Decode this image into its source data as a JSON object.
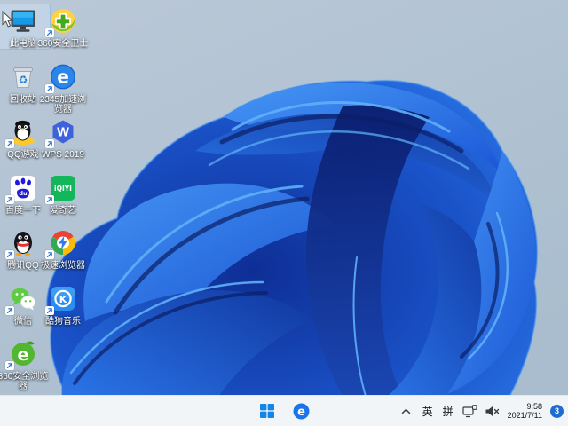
{
  "wallpaper": {
    "name": "windows-11-bloom",
    "description": "blue ribbon bloom on light blue-gray background"
  },
  "colors": {
    "background_top": "#bac8d7",
    "background_bottom": "#a9bdce",
    "bloom_bright": "#2e7ff0",
    "bloom_mid": "#1a52c8",
    "bloom_dark": "#0a1d6e",
    "taskbar_bg": "#f2f5f8",
    "selection_highlight": "#cde3f7",
    "badge": "#1f6cd0"
  },
  "desktop": {
    "icons": [
      {
        "id": "this-pc",
        "label": "此电脑",
        "glyph": "this-pc-icon",
        "col": 0,
        "row": 0,
        "shortcut": false,
        "selected": true
      },
      {
        "id": "360-safety",
        "label": "360安全卫士",
        "glyph": "shield-360-icon",
        "col": 1,
        "row": 0,
        "shortcut": true,
        "selected": false
      },
      {
        "id": "recycle-bin",
        "label": "回收站",
        "glyph": "recycle-bin-icon",
        "col": 0,
        "row": 1,
        "shortcut": false,
        "selected": false
      },
      {
        "id": "2345-browser",
        "label": "2345加速浏览器",
        "glyph": "browser-e-icon",
        "col": 1,
        "row": 1,
        "shortcut": true,
        "selected": false
      },
      {
        "id": "qq-games",
        "label": "QQ游戏",
        "glyph": "qq-game-icon",
        "col": 0,
        "row": 2,
        "shortcut": true,
        "selected": false
      },
      {
        "id": "wps-2019",
        "label": "WPS 2019",
        "glyph": "wps-icon",
        "col": 1,
        "row": 2,
        "shortcut": true,
        "selected": false
      },
      {
        "id": "baidu",
        "label": "百度一下",
        "glyph": "baidu-icon",
        "col": 0,
        "row": 3,
        "shortcut": true,
        "selected": false
      },
      {
        "id": "iqiyi",
        "label": "爱奇艺",
        "glyph": "iqiyi-icon",
        "col": 1,
        "row": 3,
        "shortcut": true,
        "selected": false
      },
      {
        "id": "tencent-qq",
        "label": "腾讯QQ",
        "glyph": "qq-icon",
        "col": 0,
        "row": 4,
        "shortcut": true,
        "selected": false
      },
      {
        "id": "speed-browser",
        "label": "极速浏览器",
        "glyph": "chrome-speed-icon",
        "col": 1,
        "row": 4,
        "shortcut": true,
        "selected": false
      },
      {
        "id": "wechat",
        "label": "微信",
        "glyph": "wechat-icon",
        "col": 0,
        "row": 5,
        "shortcut": true,
        "selected": false
      },
      {
        "id": "kugou-music",
        "label": "酷狗音乐",
        "glyph": "kugou-icon",
        "col": 1,
        "row": 5,
        "shortcut": true,
        "selected": false
      },
      {
        "id": "360-browser",
        "label": "360安全浏览器",
        "glyph": "browser-360-icon",
        "col": 0,
        "row": 6,
        "shortcut": true,
        "selected": false
      }
    ]
  },
  "taskbar": {
    "start": {
      "glyph": "windows-start-icon"
    },
    "pinned": [
      {
        "id": "browser",
        "glyph": "edge-e-icon"
      }
    ],
    "tray": {
      "hidden_icons_glyph": "chevron-up-icon",
      "ime_lang": "英",
      "ime_mode": "拼",
      "status_icons": [
        "network-icon",
        "volume-muted-icon"
      ],
      "clock": {
        "time": "9:58",
        "date": "2021/7/11"
      },
      "notification_badge": "3"
    }
  }
}
